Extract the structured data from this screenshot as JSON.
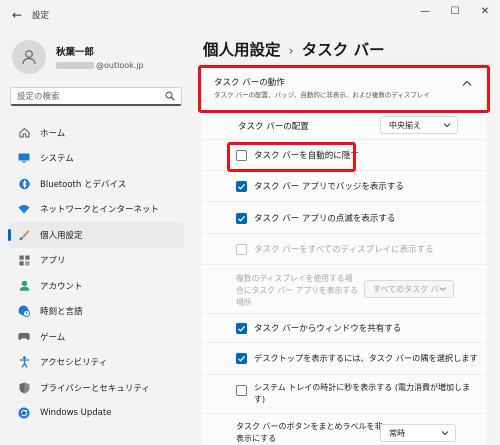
{
  "window": {
    "title": "設定",
    "back_glyph": "←",
    "minimize_glyph": "—",
    "maximize_glyph": "☐",
    "close_glyph": "✕"
  },
  "profile": {
    "name": "秋葉一郎",
    "email_suffix": "@outlook.jp"
  },
  "search": {
    "placeholder": "設定の検索"
  },
  "nav": {
    "items": [
      {
        "label": "ホーム",
        "icon": "home-icon",
        "color": "#555555"
      },
      {
        "label": "システム",
        "icon": "monitor-icon",
        "color": "#1f7ad6"
      },
      {
        "label": "Bluetooth とデバイス",
        "icon": "bluetooth-icon",
        "color": "#1f7ad6"
      },
      {
        "label": "ネットワークとインターネット",
        "icon": "wifi-icon",
        "color": "#1f7ad6"
      },
      {
        "label": "個人用設定",
        "icon": "brush-icon",
        "color": "#e07b39",
        "active": true
      },
      {
        "label": "アプリ",
        "icon": "apps-icon",
        "color": "#6b6b6b"
      },
      {
        "label": "アカウント",
        "icon": "account-icon",
        "color": "#27a36b"
      },
      {
        "label": "時刻と言語",
        "icon": "globe-clock-icon",
        "color": "#1f7ad6"
      },
      {
        "label": "ゲーム",
        "icon": "gamepad-icon",
        "color": "#6b6b6b"
      },
      {
        "label": "アクセシビリティ",
        "icon": "accessibility-icon",
        "color": "#1f7ad6"
      },
      {
        "label": "プライバシーとセキュリティ",
        "icon": "shield-icon",
        "color": "#6b6b6b"
      },
      {
        "label": "Windows Update",
        "icon": "update-icon",
        "color": "#1f7ad6"
      }
    ]
  },
  "breadcrumb": {
    "parent": "個人用設定",
    "separator": "›",
    "current": "タスク バー"
  },
  "section": {
    "title": "タスク バーの動作",
    "subtitle": "タスク バーの配置、バッジ、自動的に非表示、および複数のディスプレイ",
    "chevron": "chevron-up-icon"
  },
  "settings": {
    "alignment": {
      "label": "タスク バーの配置",
      "value": "中央揃え"
    },
    "auto_hide": {
      "label": "タスク バーを自動的に隠す",
      "checked": false
    },
    "badges": {
      "label": "タスク バー アプリでバッジを表示する",
      "checked": true
    },
    "flashing": {
      "label": "タスク バー アプリの点滅を表示する",
      "checked": true
    },
    "all_displays": {
      "label": "タスク バーをすべてのディスプレイに表示する",
      "checked": false,
      "disabled": true
    },
    "multi_display": {
      "label_line1": "複数のディスプレイを使用する場",
      "label_line2": "合にタスク バー アプリを表示する",
      "label_line3": "場所",
      "value": "すべてのタスク バー",
      "disabled": true
    },
    "share_window": {
      "label": "タスク バーからウィンドウを共有する",
      "checked": true
    },
    "show_desktop": {
      "label": "デスクトップを表示するには、タスク バーの隅を選択します",
      "checked": true
    },
    "seconds": {
      "label_line1": "システム トレイの時計に秒を表示する (電力消費が増加しま",
      "label_line2": "す)",
      "checked": false
    },
    "combine": {
      "label_line1": "タスク バーのボタンをまとめラベルを非",
      "label_line2": "表示にする",
      "value": "常時"
    }
  },
  "colors": {
    "accent": "#0067c0",
    "highlight": "#e8121a"
  }
}
